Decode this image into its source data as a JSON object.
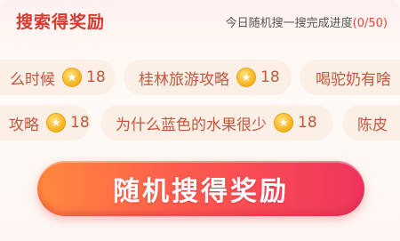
{
  "header": {
    "title": "搜索得奖励",
    "progress_prefix": "今日随机搜一搜完成进度",
    "progress_value": "(0/50)"
  },
  "row1": [
    {
      "label": "么时候",
      "points": "18"
    },
    {
      "label": "桂林旅游攻略",
      "points": "18"
    },
    {
      "label": "喝驼奶有啥"
    }
  ],
  "row2": [
    {
      "label": "攻略",
      "points": "18"
    },
    {
      "label": "为什么蓝色的水果很少",
      "points": "18"
    },
    {
      "label": "陈皮"
    }
  ],
  "coin_icon": "star-coin-icon",
  "button": {
    "label": "随机搜得奖励"
  }
}
